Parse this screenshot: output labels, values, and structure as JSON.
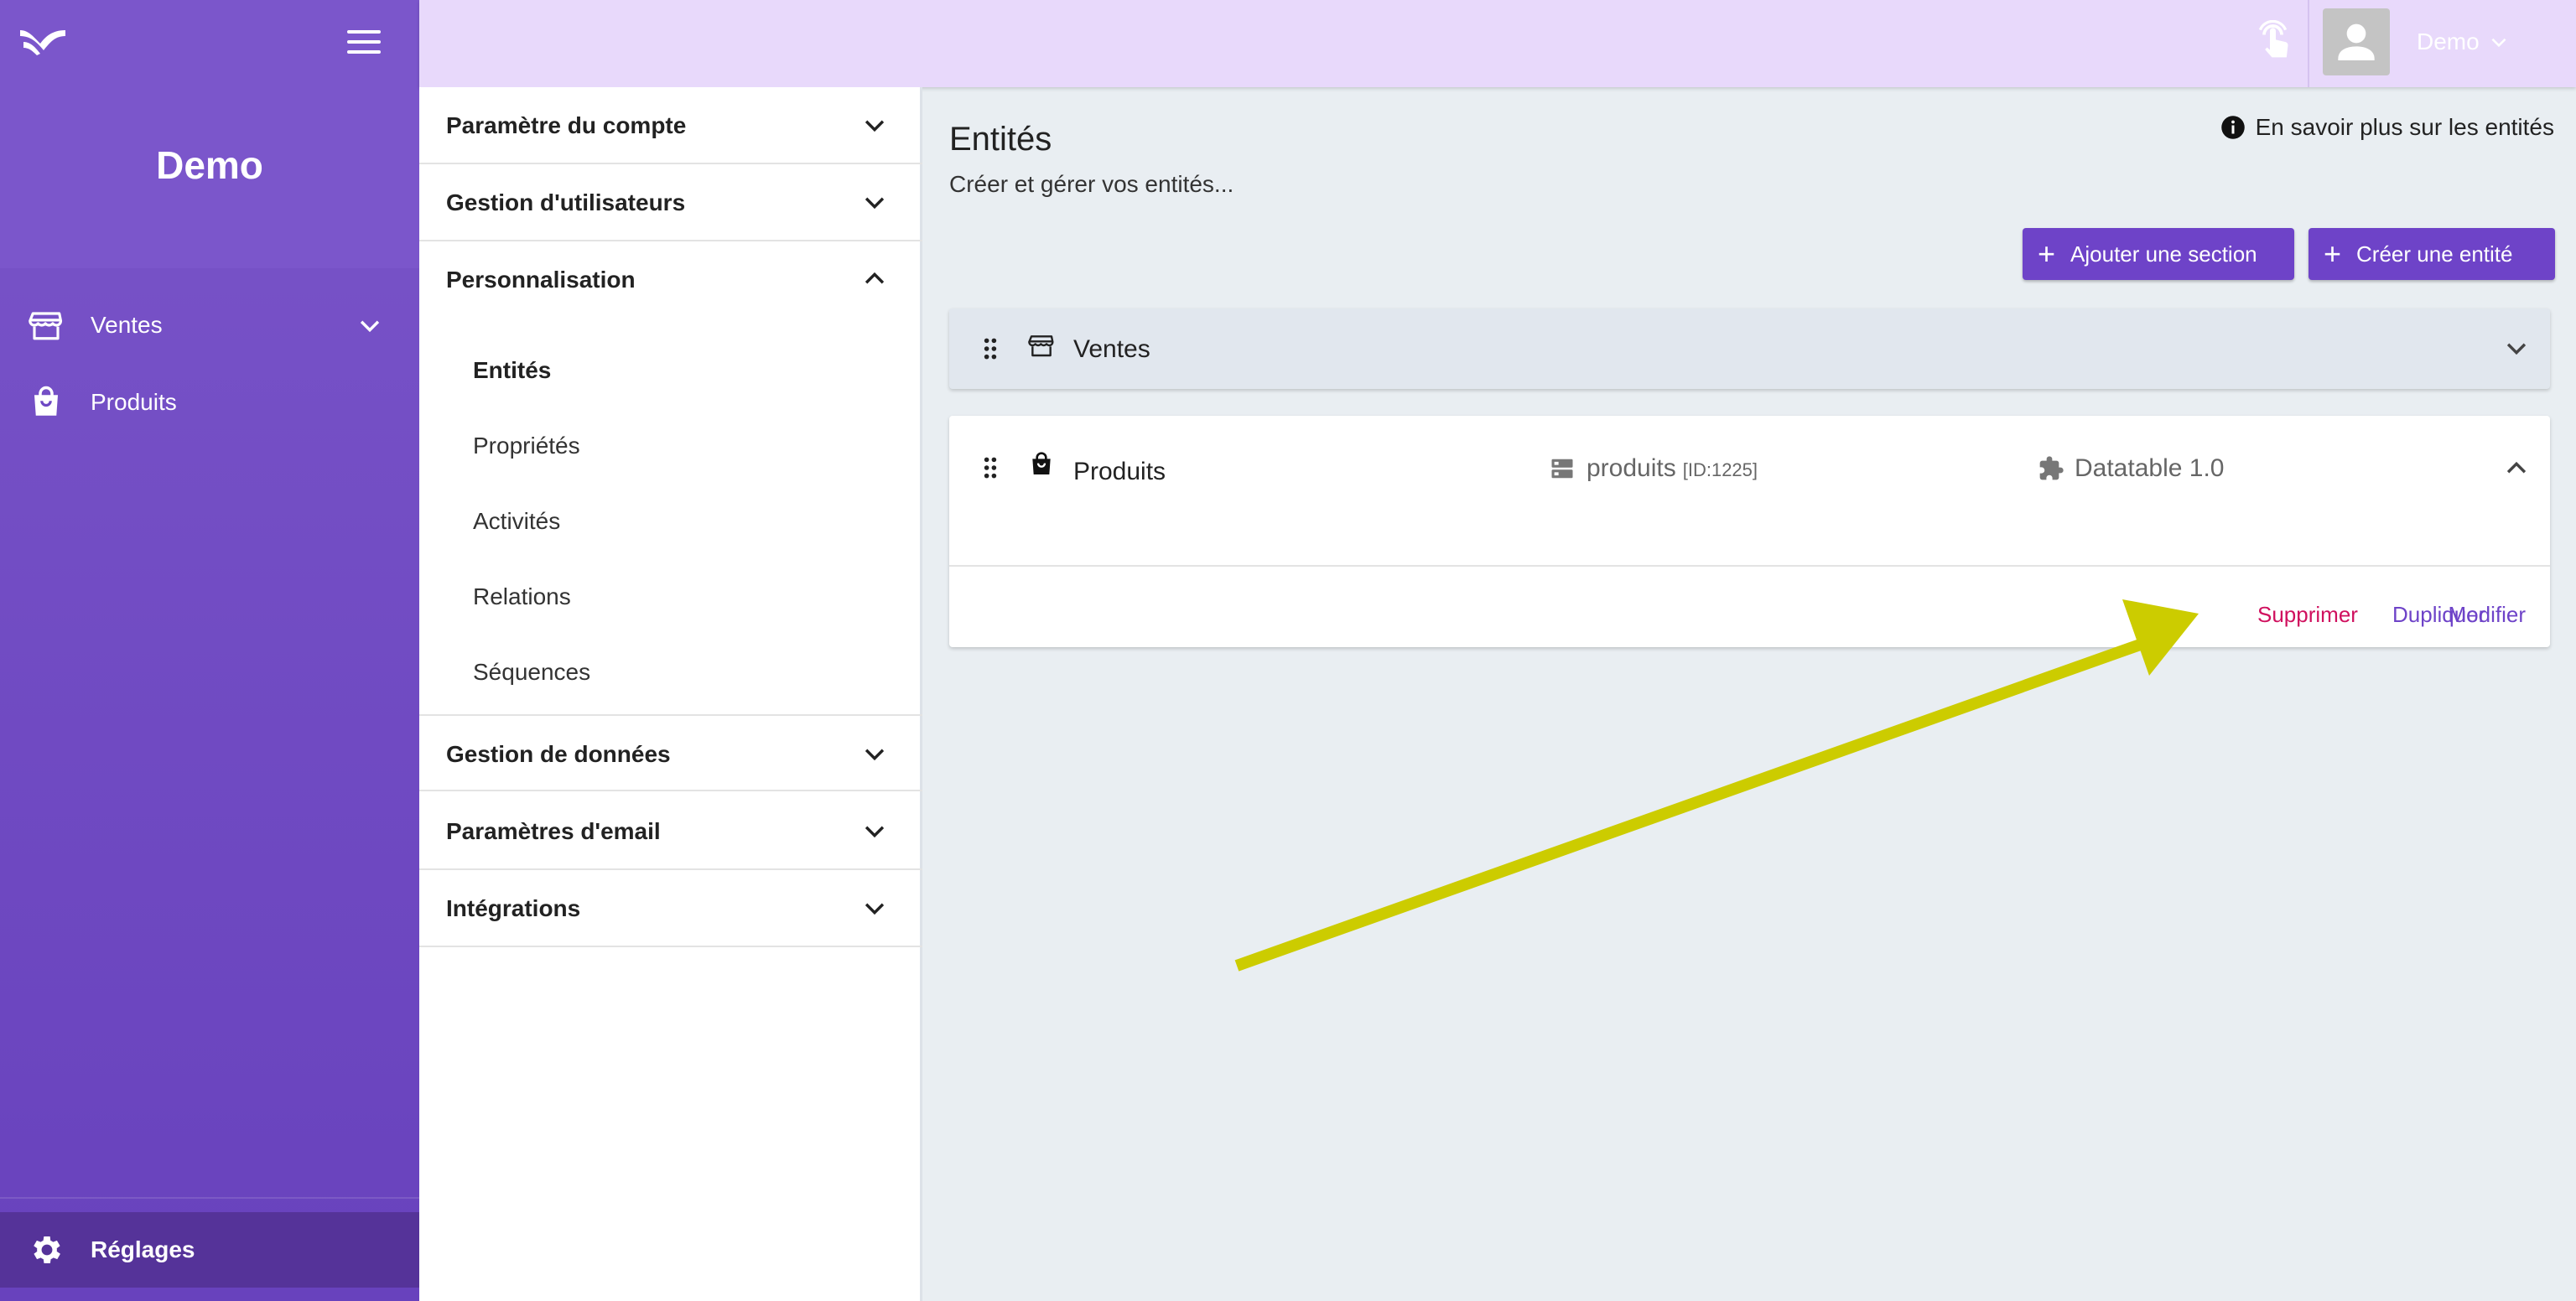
{
  "sidebar": {
    "brand": "Demo",
    "items": [
      {
        "label": "Ventes",
        "icon": "store-icon"
      },
      {
        "label": "Produits",
        "icon": "shopping-bag-icon"
      }
    ],
    "settings_label": "Réglages"
  },
  "topbar": {
    "user_name": "Demo"
  },
  "menu": {
    "sections": [
      {
        "label": "Paramètre du compte",
        "expanded": false
      },
      {
        "label": "Gestion d'utilisateurs",
        "expanded": false
      },
      {
        "label": "Personnalisation",
        "expanded": true
      },
      {
        "label": "Gestion de données",
        "expanded": false
      },
      {
        "label": "Paramètres d'email",
        "expanded": false
      },
      {
        "label": "Intégrations",
        "expanded": false
      }
    ],
    "sub_items": [
      "Entités",
      "Propriétés",
      "Activités",
      "Relations",
      "Séquences"
    ],
    "active_sub": "Entités"
  },
  "main": {
    "title": "Entités",
    "subtitle": "Créer et gérer vos entités...",
    "learn_more": "En savoir plus sur les entités",
    "add_section_label": "Ajouter une section",
    "create_entity_label": "Créer une entité",
    "section": {
      "name": "Ventes",
      "icon": "store-icon"
    },
    "entity": {
      "name": "Produits",
      "icon": "shopping-bag-icon",
      "table": "produits",
      "table_id": "[ID:1225]",
      "plugin": "Datatable 1.0",
      "actions": {
        "delete": "Supprimer",
        "duplicate": "Dupliquer",
        "edit": "Modifier"
      }
    }
  },
  "colors": {
    "sidebar": "#6e48c4",
    "topbar": "#e8d9fb",
    "accent": "#6e43c8",
    "danger": "#d0105e",
    "annotation_arrow": "#cccc00"
  }
}
